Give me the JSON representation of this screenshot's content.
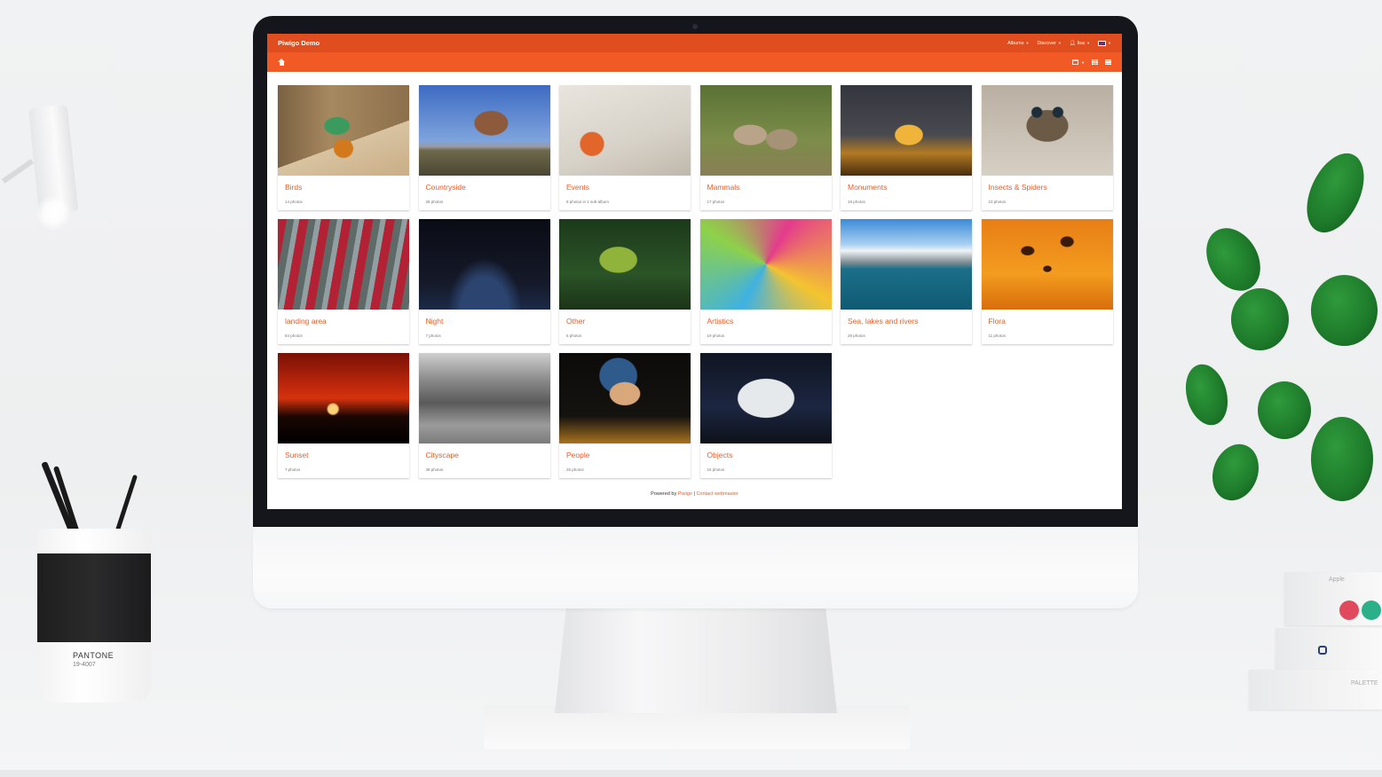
{
  "scene": {
    "pen_cup": {
      "brand": "PANTONE",
      "code": "19-4007"
    },
    "books": {
      "top_label": "Apple",
      "bottom_label": "PALETTE"
    }
  },
  "header": {
    "brand": "Piwigo Demo",
    "nav": [
      {
        "label": "Albums",
        "icon": "caret-down-icon"
      },
      {
        "label": "Discover",
        "icon": "caret-down-icon"
      },
      {
        "label": "lisa",
        "icon": "user-icon"
      }
    ],
    "language_flag": "uk-flag-icon"
  },
  "toolbar": {
    "home_icon": "home-icon",
    "tools": [
      "calendar-icon",
      "grid-view-icon",
      "list-view-icon"
    ]
  },
  "albums": [
    {
      "title": "Birds",
      "count": "14 photos",
      "thumb": "t-birds"
    },
    {
      "title": "Countryside",
      "count": "28 photos",
      "thumb": "t-country"
    },
    {
      "title": "Events",
      "count": "8 photos in 1 sub-album",
      "thumb": "t-events"
    },
    {
      "title": "Mammals",
      "count": "17 photos",
      "thumb": "t-mammals"
    },
    {
      "title": "Monuments",
      "count": "19 photos",
      "thumb": "t-monu"
    },
    {
      "title": "Insects & Spiders",
      "count": "10 photos",
      "thumb": "t-insects"
    },
    {
      "title": "landing area",
      "count": "84 photos",
      "thumb": "t-landing"
    },
    {
      "title": "Night",
      "count": "7 photos",
      "thumb": "t-night"
    },
    {
      "title": "Other",
      "count": "5 photos",
      "thumb": "t-other"
    },
    {
      "title": "Artistics",
      "count": "19 photos",
      "thumb": "t-art"
    },
    {
      "title": "Sea, lakes and rivers",
      "count": "29 photos",
      "thumb": "t-sea"
    },
    {
      "title": "Flora",
      "count": "11 photos",
      "thumb": "t-flora"
    },
    {
      "title": "Sunset",
      "count": "7 photos",
      "thumb": "t-sunset"
    },
    {
      "title": "Cityscape",
      "count": "38 photos",
      "thumb": "t-city"
    },
    {
      "title": "People",
      "count": "26 photos",
      "thumb": "t-people"
    },
    {
      "title": "Objects",
      "count": "16 photos",
      "thumb": "t-objects"
    }
  ],
  "footer": {
    "powered_by": "Powered by",
    "piwigo_link": "Piwigo",
    "separator": "|",
    "contact_link": "Contact webmaster"
  },
  "colors": {
    "topbar": "#e04d1f",
    "subbar": "#f15a24",
    "accent": "#f15a24"
  }
}
